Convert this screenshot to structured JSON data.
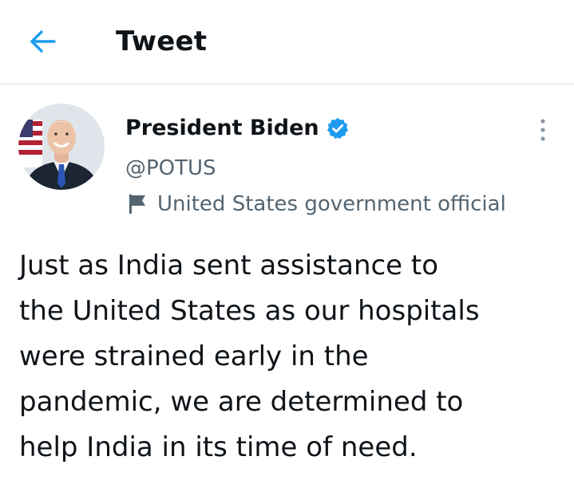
{
  "header": {
    "title": "Tweet",
    "back_icon": "arrow-left-icon",
    "accent_color": "#1d9bf0"
  },
  "author": {
    "display_name": "President Biden",
    "handle": "@POTUS",
    "verified": true,
    "verified_icon": "verified-badge-icon",
    "label_icon": "flag-icon",
    "label": "United States government official",
    "more_icon": "more-vertical-icon"
  },
  "tweet": {
    "text": "Just as India sent assistance to\nthe United States as our hospitals\nwere strained early in the\npandemic, we are determined to\nhelp India in its time of need."
  },
  "colors": {
    "text_primary": "#0f1419",
    "text_secondary": "#536471",
    "divider": "#d6d9db",
    "verified_blue": "#1d9bf0"
  }
}
